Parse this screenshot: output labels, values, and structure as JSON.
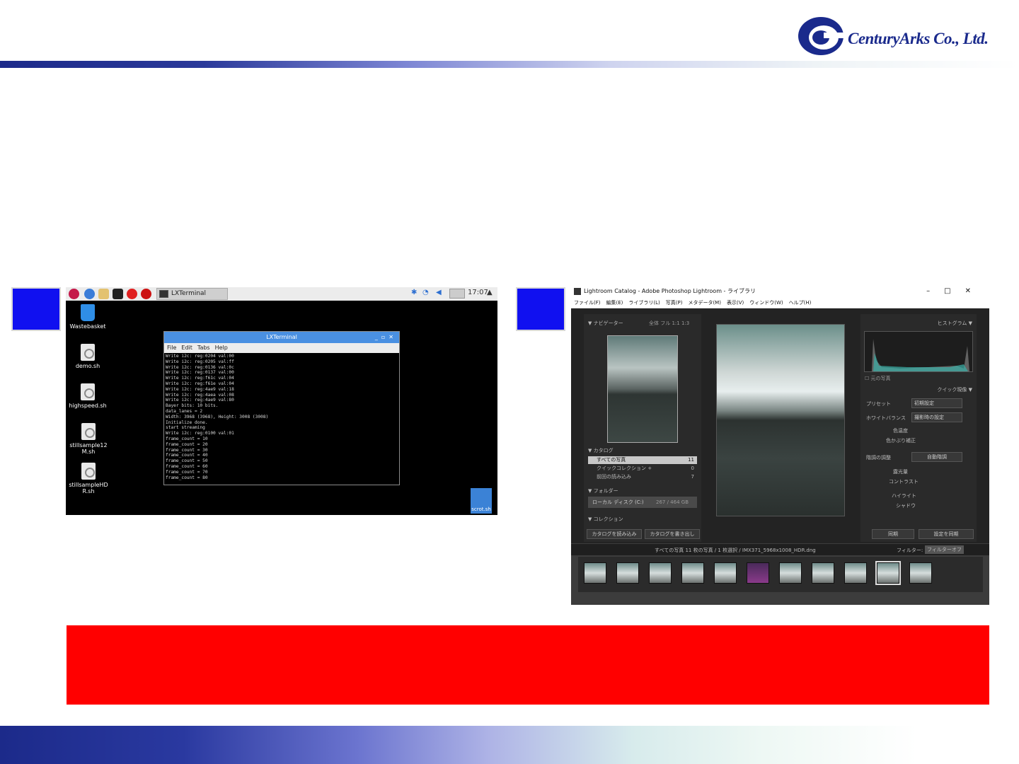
{
  "logo": {
    "company": "CenturyArks Co., Ltd."
  },
  "rpi": {
    "taskbar": {
      "task_label": "LXTerminal",
      "clock": "17:07"
    },
    "desktop_icons": [
      "Wastebasket",
      "demo.sh",
      "highspeed.sh",
      "stillsample12M.sh",
      "stillsampleHDR.sh",
      "scrot.sh"
    ],
    "terminal": {
      "title": "LXTerminal",
      "menu": [
        "File",
        "Edit",
        "Tabs",
        "Help"
      ],
      "lines": [
        "Write i2c: reg:0204 val:00",
        "Write i2c: reg:0205 val:ff",
        "Write i2c: reg:0136 val:0c",
        "Write i2c: reg:0137 val:00",
        "Write i2c: reg:f61c val:04",
        "Write i2c: reg:f61e val:04",
        "Write i2c: reg:4ae9 val:18",
        "Write i2c: reg:4aea val:08",
        "Write i2c: reg:4ae9 val:80",
        "Bayer bits: 10 bits.",
        "data_lanes = 2",
        "Width: 3968 (3968), Height: 3008 (3008)",
        "Initialize done.",
        "start streaming",
        "Write i2c: reg:0100 val:01",
        "frame_count = 10",
        "frame_count = 20",
        "frame_count = 30",
        "frame_count = 40",
        "frame_count = 50",
        "frame_count = 60",
        "frame_count = 70",
        "frame_count = 80"
      ]
    }
  },
  "lightroom": {
    "title": "Lightroom Catalog - Adobe Photoshop Lightroom - ライブラリ",
    "menu": [
      "ファイル(F)",
      "編集(E)",
      "ライブラリ(L)",
      "写真(P)",
      "メタデータ(M)",
      "表示(V)",
      "ウィンドウ(W)",
      "ヘルプ(H)"
    ],
    "navigator": "ナビゲーター",
    "nav_tabs": "全体  フル  1:1  1:3",
    "catalog": "カタログ",
    "catalog_items": [
      {
        "label": "すべての写真",
        "count": "11"
      },
      {
        "label": "クイックコレクション +",
        "count": "0"
      },
      {
        "label": "前回の読み込み",
        "count": "7"
      }
    ],
    "folder": "フォルダー",
    "local_disk": "ローカル ディスク (C:)",
    "disk_size": "267 / 464 GB",
    "collection": "コレクション",
    "import_btn": "カタログを読み込み",
    "export_btn": "カタログを書き出し",
    "histogram": "ヒストグラム",
    "original_photo": "元の写真",
    "quick_develop": "クイック現像",
    "preset": "プリセット",
    "preset_value": "初期設定",
    "white_balance": "ホワイトバランス",
    "wb_value": "撮影時の設定",
    "temp": "色温度",
    "tint": "色かぶり補正",
    "tone": "階調の調整",
    "auto_tone": "自動階調",
    "exposure": "露光量",
    "contrast": "コントラスト",
    "highlights": "ハイライト",
    "shadows": "シャドウ",
    "sync": "同期",
    "sync_settings": "設定を同期",
    "strip_info": "すべての写真   11 枚の写真 / 1 枚選択 / IMX371_5968x1008_HDR.dng",
    "filter_label": "フィルター:",
    "filter_value": "フィルターオフ"
  }
}
